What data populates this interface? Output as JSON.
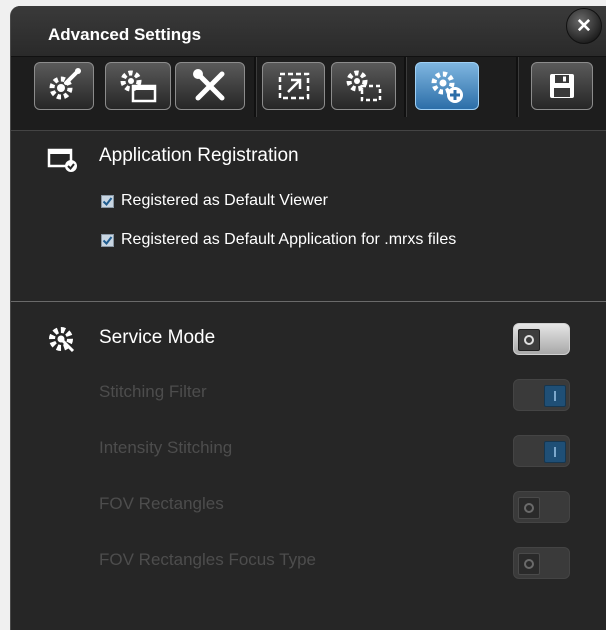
{
  "window": {
    "title": "Advanced Settings",
    "close_glyph": "✕"
  },
  "toolbar": {
    "buttons": [
      {
        "icon": "gear-pin-icon"
      },
      {
        "icon": "gear-window-icon"
      },
      {
        "icon": "wrench-screwdriver-icon"
      },
      {
        "icon": "dashed-frame-icon"
      },
      {
        "icon": "gear-frame-icon"
      },
      {
        "icon": "gear-plus-icon",
        "active": true
      },
      {
        "icon": "save-icon"
      }
    ]
  },
  "app_registration": {
    "title": "Application Registration",
    "options": [
      {
        "label": "Registered as Default Viewer",
        "checked": true
      },
      {
        "label": "Registered as Default Application for .mrxs files",
        "checked": true
      }
    ]
  },
  "service_mode": {
    "title": "Service Mode",
    "enabled": false,
    "items": [
      {
        "label": "Stitching Filter",
        "on": true
      },
      {
        "label": "Intensity Stitching",
        "on": true
      },
      {
        "label": "FOV Rectangles",
        "on": false
      },
      {
        "label": "FOV Rectangles Focus Type",
        "on": false
      }
    ]
  },
  "colors": {
    "background": "#262626",
    "active_accent": "#4a8fc8",
    "disabled_text": "#4d4d4d"
  }
}
